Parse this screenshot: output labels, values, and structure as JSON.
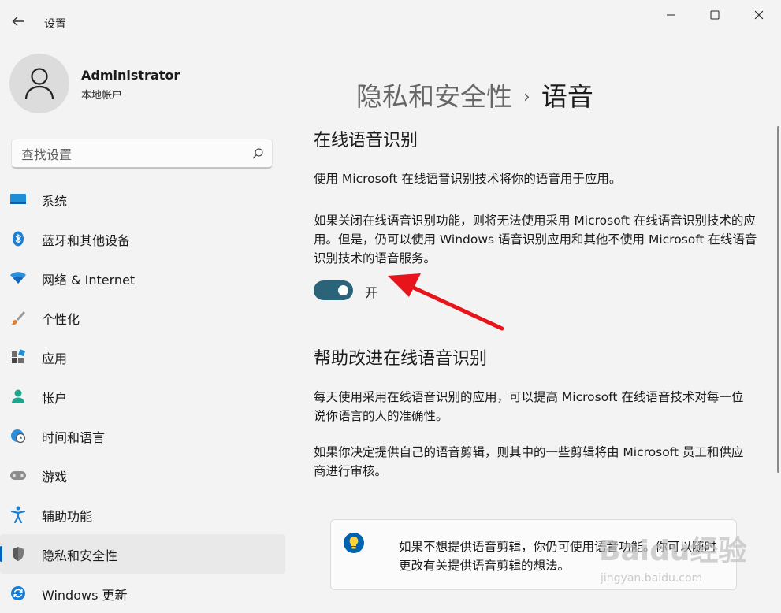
{
  "titlebar": {
    "app_title": "设置",
    "back_icon": "arrow-left-icon",
    "minimize_icon": "minimize-icon",
    "maximize_icon": "maximize-icon",
    "close_icon": "close-icon"
  },
  "profile": {
    "name": "Administrator",
    "account_type": "本地帐户",
    "avatar_icon": "person-icon"
  },
  "search": {
    "placeholder": "查找设置",
    "icon": "search-icon"
  },
  "sidebar": {
    "items": [
      {
        "label": "系统",
        "icon": "monitor-icon",
        "active": false
      },
      {
        "label": "蓝牙和其他设备",
        "icon": "bluetooth-icon",
        "active": false
      },
      {
        "label": "网络 & Internet",
        "icon": "wifi-icon",
        "active": false
      },
      {
        "label": "个性化",
        "icon": "brush-icon",
        "active": false
      },
      {
        "label": "应用",
        "icon": "apps-icon",
        "active": false
      },
      {
        "label": "帐户",
        "icon": "account-icon",
        "active": false
      },
      {
        "label": "时间和语言",
        "icon": "globe-clock-icon",
        "active": false
      },
      {
        "label": "游戏",
        "icon": "gamepad-icon",
        "active": false
      },
      {
        "label": "辅助功能",
        "icon": "accessibility-icon",
        "active": false
      },
      {
        "label": "隐私和安全性",
        "icon": "shield-icon",
        "active": true
      },
      {
        "label": "Windows 更新",
        "icon": "update-icon",
        "active": false
      }
    ],
    "accent_color": "#005fb8"
  },
  "breadcrumb": {
    "parent": "隐私和安全性",
    "separator": "›",
    "current": "语音"
  },
  "section_online": {
    "title": "在线语音识别",
    "description": "使用 Microsoft 在线语音识别技术将你的语音用于应用。",
    "note": "如果关闭在线语音识别功能，则将无法使用采用 Microsoft 在线语音识别技术的应用。但是，仍可以使用 Windows 语音识别应用和其他不使用 Microsoft 在线语音识别技术的语音服务。",
    "toggle_state": "开",
    "toggle_on": true,
    "toggle_color": "#2b6478"
  },
  "section_improve": {
    "title": "帮助改进在线语音识别",
    "paragraph1": "每天使用采用在线语音识别的应用，可以提高 Microsoft 在线语音技术对每一位说你语言的人的准确性。",
    "paragraph2": "如果你决定提供自己的语音剪辑，则其中的一些剪辑将由 Microsoft 员工和供应商进行审核。"
  },
  "info_card": {
    "icon": "lightbulb-icon",
    "text": "如果不想提供语音剪辑，你仍可使用语音功能。你可以随时更改有关提供语音剪辑的想法。"
  },
  "annotation": {
    "arrow_color": "#e8141b"
  },
  "watermark": {
    "logo": "Baidu经验",
    "url": "jingyan.baidu.com"
  }
}
